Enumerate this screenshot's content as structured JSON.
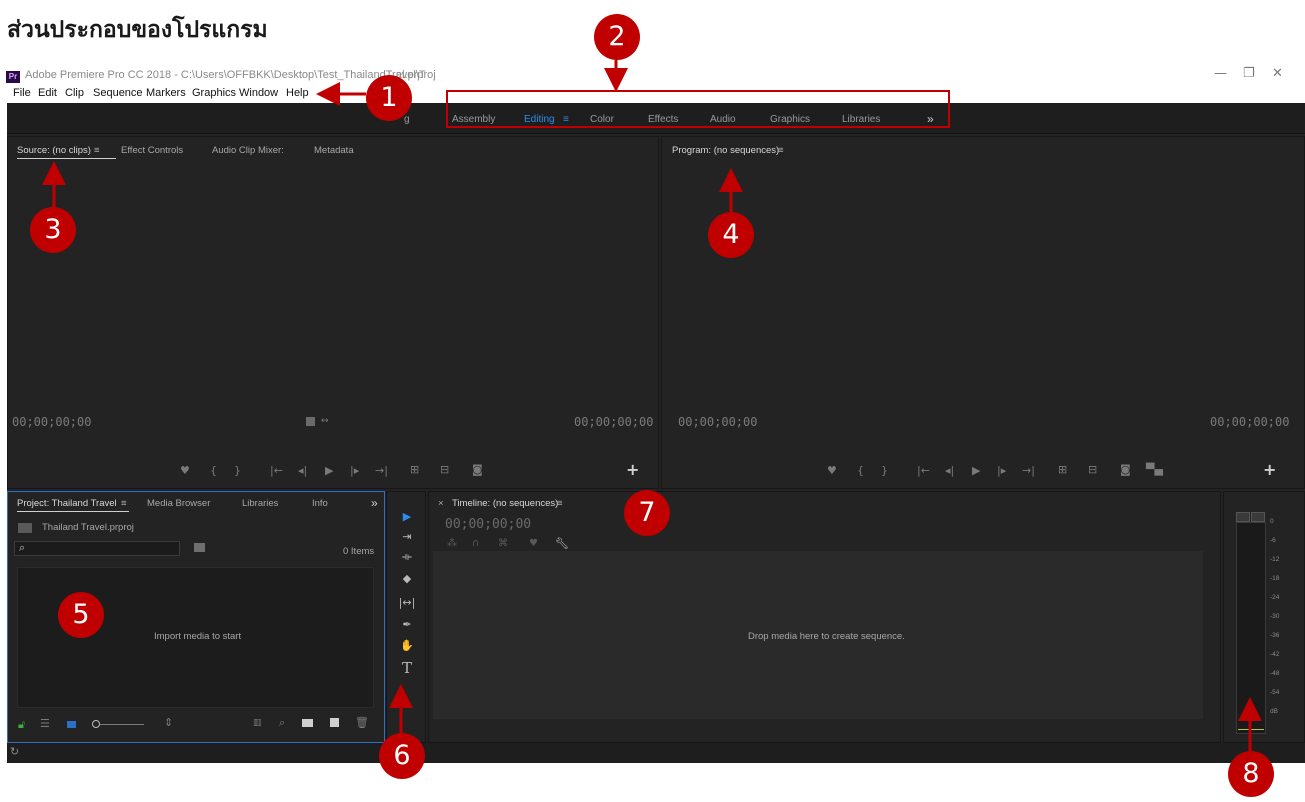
{
  "heading": "ส่วนประกอบของโปรแกรม",
  "window": {
    "title": "Adobe Premiere Pro CC 2018 - C:\\Users\\OFFBKK\\Desktop\\Test_ThailandTravel\\T",
    "title_tail": "el.prproj",
    "app_icon": "Pr",
    "minimize": "—",
    "restore": "❐",
    "close": "✕"
  },
  "menu": [
    "File",
    "Edit",
    "Clip",
    "Sequence",
    "Markers",
    "Graphics",
    "Window",
    "Help"
  ],
  "workspaces": {
    "partial": "g",
    "items": [
      "Assembly",
      "Editing",
      "Color",
      "Effects",
      "Audio",
      "Graphics",
      "Libraries"
    ],
    "active": "Editing",
    "overflow": "»",
    "menu_icon": "≡"
  },
  "source_panel": {
    "tabs": [
      "Source: (no clips)",
      "Effect Controls",
      "Audio Clip Mixer:",
      "Metadata"
    ],
    "timecode_left": "00;00;00;00",
    "timecode_right": "00;00;00;00",
    "add": "+"
  },
  "program_panel": {
    "tab": "Program: (no sequences)",
    "timecode_left": "00;00;00;00",
    "timecode_right": "00;00;00;00",
    "add": "+"
  },
  "project_panel": {
    "tabs": [
      "Project: Thailand Travel",
      "Media Browser",
      "Libraries",
      "Info"
    ],
    "overflow": "»",
    "file": "Thailand Travel.prproj",
    "items_count": "0 Items",
    "empty_message": "Import media to start"
  },
  "timeline_panel": {
    "close": "×",
    "tab": "Timeline: (no sequences)",
    "timecode": "00;00;00;00",
    "empty_message": "Drop media here to create sequence."
  },
  "audio_meter": {
    "ticks": [
      "0",
      "-6",
      "-12",
      "-18",
      "-24",
      "-30",
      "-36",
      "-42",
      "-48",
      "-54",
      "dB"
    ]
  },
  "callouts": [
    "1",
    "2",
    "3",
    "4",
    "5",
    "6",
    "7",
    "8"
  ],
  "colors": {
    "accent": "#2d8ceb",
    "callout": "#c00000",
    "highlight_box": "#c00000"
  }
}
